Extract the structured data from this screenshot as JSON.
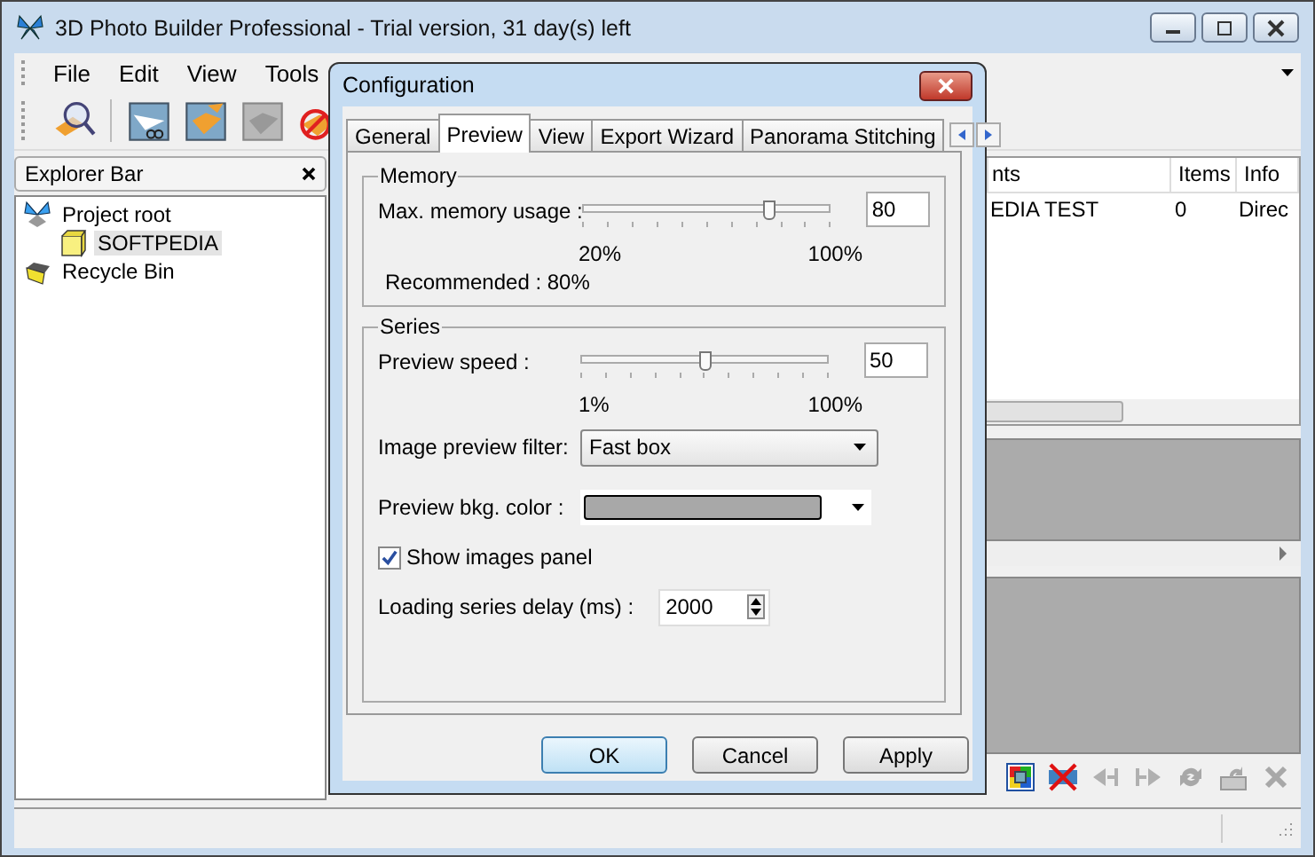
{
  "window": {
    "title": "3D Photo Builder Professional - Trial version, 31 day(s) left"
  },
  "menu": [
    "File",
    "Edit",
    "View",
    "Tools"
  ],
  "explorer_bar": {
    "title": "Explorer Bar",
    "tree": [
      {
        "label": "Project root",
        "kind": "root",
        "selected": false,
        "children": [
          {
            "label": "SOFTPEDIA",
            "kind": "folder",
            "selected": true
          }
        ]
      },
      {
        "label": "Recycle Bin",
        "kind": "bin",
        "selected": false
      }
    ]
  },
  "list": {
    "columns": [
      "nts",
      "Items",
      "Info"
    ],
    "rows": [
      [
        "EDIA TEST",
        "0",
        "Direc"
      ]
    ]
  },
  "dialog": {
    "title": "Configuration",
    "tabs": [
      {
        "label": "General",
        "selected": false
      },
      {
        "label": "Preview",
        "selected": true
      },
      {
        "label": "View",
        "selected": false
      },
      {
        "label": "Export Wizard",
        "selected": false
      },
      {
        "label": "Panorama Stitching",
        "selected": false
      }
    ],
    "memory": {
      "legend": "Memory",
      "label": "Max. memory usage :",
      "level": 0.75,
      "value": "80",
      "min_label": "20%",
      "max_label": "100%",
      "note": "Recommended : 80%"
    },
    "series": {
      "legend": "Series",
      "speed": {
        "label": "Preview speed :",
        "level": 0.5,
        "value": "50",
        "min_label": "1%",
        "max_label": "100%"
      },
      "filter": {
        "label": "Image preview filter:",
        "value": "Fast box"
      },
      "bkg_color": {
        "label": "Preview bkg. color :",
        "color": "#a8a8a8"
      },
      "show_images": {
        "label": "Show images panel",
        "checked": true
      },
      "delay": {
        "label": "Loading series delay (ms) :",
        "value": "2000"
      }
    },
    "buttons": [
      {
        "label": "OK",
        "default": true
      },
      {
        "label": "Cancel",
        "default": false
      },
      {
        "label": "Apply",
        "default": false
      }
    ]
  }
}
